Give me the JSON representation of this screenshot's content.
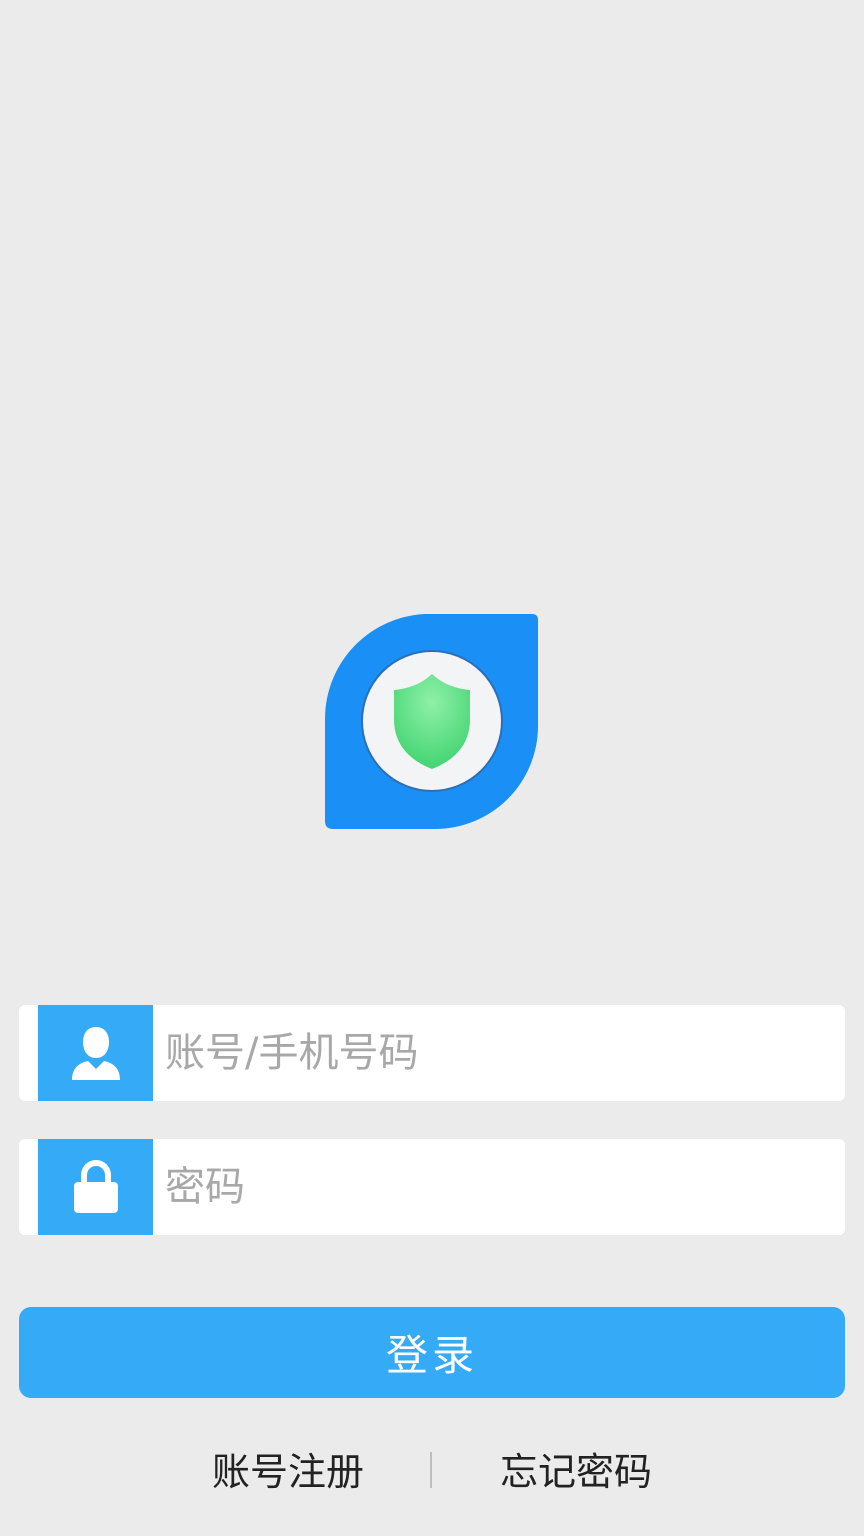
{
  "logo": {
    "icon": "shield-icon",
    "colors": {
      "outer": "#1a8ff5",
      "ring": "#f3f4f6",
      "shield": "#4fdc7e"
    }
  },
  "account_field": {
    "icon": "user-icon",
    "placeholder": "账号/手机号码",
    "value": ""
  },
  "password_field": {
    "icon": "lock-icon",
    "placeholder": "密码",
    "value": ""
  },
  "login_button": {
    "label": "登录",
    "color": "#35aaf7"
  },
  "links": {
    "register": "账号注册",
    "forgot_password": "忘记密码"
  }
}
